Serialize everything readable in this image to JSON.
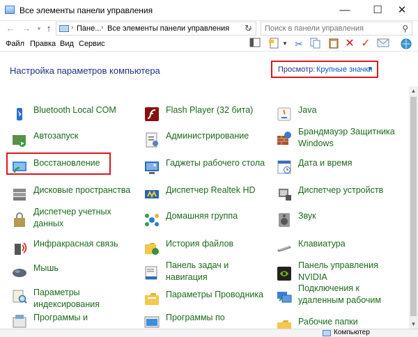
{
  "window": {
    "title": "Все элементы панели управления",
    "minimize_glyph": "—",
    "maximize_glyph": "☐",
    "close_glyph": "✕"
  },
  "address_bar": {
    "back_icon": "arrow-left-icon",
    "forward_icon": "arrow-right-icon",
    "recent_icon": "chevron-down-icon",
    "up_icon": "arrow-up-icon",
    "crumbs": [
      "Пане...",
      "Все элементы панели управления"
    ],
    "search_placeholder": "Поиск в панели управления"
  },
  "menu": {
    "items": [
      "Файл",
      "Правка",
      "Вид",
      "Сервис"
    ]
  },
  "toolbar": {
    "icons": [
      "preview-pane-icon",
      "properties-icon",
      "cut-icon",
      "copy-icon",
      "paste-icon",
      "delete-icon",
      "checkmark-icon",
      "email-icon",
      "globe-icon"
    ]
  },
  "header": {
    "title": "Настройка параметров компьютера",
    "view_label": "Просмотр:",
    "view_value": "Крупные значки",
    "view_caret": "▼"
  },
  "items": [
    {
      "label": "Bluetooth Local COM",
      "icon": "bluetooth-device-icon"
    },
    {
      "label": "Автозапуск",
      "icon": "autoplay-icon"
    },
    {
      "label": "Восстановление",
      "icon": "recovery-icon"
    },
    {
      "label": "Дисковые пространства",
      "icon": "storage-spaces-icon"
    },
    {
      "label": "Диспетчер учетных данных",
      "icon": "credential-manager-icon"
    },
    {
      "label": "Инфракрасная связь",
      "icon": "infrared-icon"
    },
    {
      "label": "Мышь",
      "icon": "mouse-icon"
    },
    {
      "label": "Параметры индексирования",
      "icon": "indexing-options-icon"
    },
    {
      "label": "Программы и",
      "icon": "programs-features-icon"
    },
    {
      "label": "Flash Player (32 бита)",
      "icon": "flash-player-icon"
    },
    {
      "label": "Администрирование",
      "icon": "administrative-tools-icon"
    },
    {
      "label": "Гаджеты рабочего стола",
      "icon": "desktop-gadgets-icon"
    },
    {
      "label": "Диспетчер Realtek HD",
      "icon": "realtek-audio-icon"
    },
    {
      "label": "Домашняя группа",
      "icon": "homegroup-icon"
    },
    {
      "label": "История файлов",
      "icon": "file-history-icon"
    },
    {
      "label": "Панель задач и навигация",
      "icon": "taskbar-icon"
    },
    {
      "label": "Параметры Проводника",
      "icon": "explorer-options-icon"
    },
    {
      "label": "Программы по",
      "icon": "default-programs-icon"
    },
    {
      "label": "Java",
      "icon": "java-icon"
    },
    {
      "label": "Брандмауэр Защитника Windows",
      "icon": "firewall-icon"
    },
    {
      "label": "Дата и время",
      "icon": "date-time-icon"
    },
    {
      "label": "Диспетчер устройств",
      "icon": "device-manager-icon"
    },
    {
      "label": "Звук",
      "icon": "sound-icon"
    },
    {
      "label": "Клавиатура",
      "icon": "keyboard-icon"
    },
    {
      "label": "Панель управления NVIDIA",
      "icon": "nvidia-icon"
    },
    {
      "label": "Подключения к удаленным рабочим",
      "icon": "remote-desktop-icon"
    },
    {
      "label": "Рабочие папки",
      "icon": "work-folders-icon"
    }
  ],
  "status": {
    "text": "Компьютер"
  }
}
